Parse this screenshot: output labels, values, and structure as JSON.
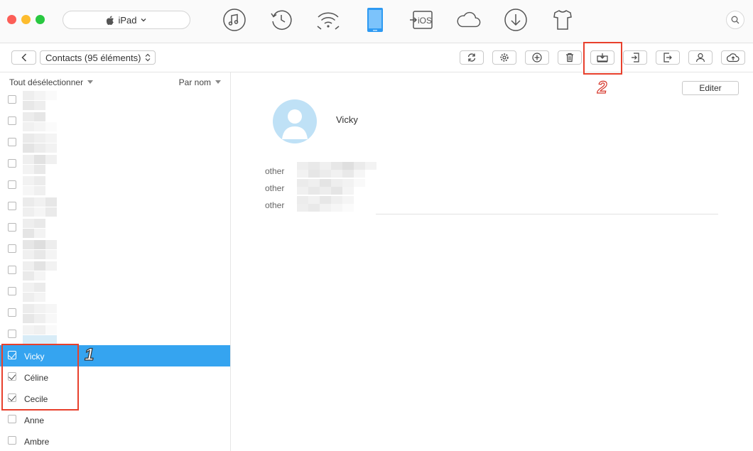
{
  "window": {
    "device_label": "iPad"
  },
  "nav_icons": [
    "music-icon",
    "history-icon",
    "wifi-icon",
    "device-icon",
    "ios-transfer-icon",
    "cloud-icon",
    "download-icon",
    "tshirt-icon"
  ],
  "ios_label": "iOS",
  "toolbar": {
    "category_select": "Contacts (95 éléments)",
    "tools": [
      "refresh-icon",
      "settings-icon",
      "add-icon",
      "delete-icon",
      "export-to-computer-icon",
      "import-icon",
      "export-icon",
      "contact-icon",
      "upload-cloud-icon"
    ]
  },
  "list": {
    "select_all_label": "Tout désélectionner",
    "sort_label": "Par nom",
    "named_contacts": [
      {
        "name": "Vicky",
        "checked": true,
        "selected": true
      },
      {
        "name": "Céline",
        "checked": true,
        "selected": false
      },
      {
        "name": "Cecile",
        "checked": true,
        "selected": false
      },
      {
        "name": "Anne",
        "checked": false,
        "selected": false
      },
      {
        "name": "Ambre",
        "checked": false,
        "selected": false
      }
    ]
  },
  "detail": {
    "edit_label": "Editer",
    "name": "Vicky",
    "fields": [
      {
        "label": "other"
      },
      {
        "label": "other"
      },
      {
        "label": "other"
      }
    ]
  },
  "annotations": {
    "one": "1",
    "two": "2"
  },
  "colors": {
    "selected_row": "#35a4f0",
    "annotation": "#e8402c",
    "avatar_bg": "#bfe1f6"
  }
}
